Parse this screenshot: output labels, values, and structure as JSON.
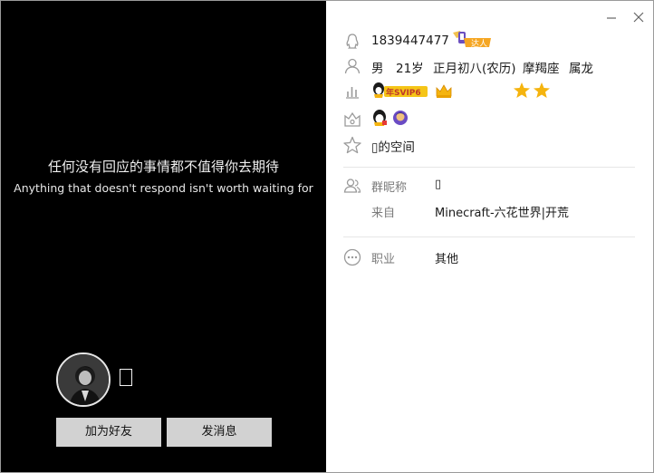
{
  "profile": {
    "signature_cn": "任何没有回应的事情都不值得你去期待",
    "signature_en": "Anything that doesn't respond isn't worth waiting for",
    "nickname": "▯",
    "add_friend_label": "加为好友",
    "send_message_label": "发消息"
  },
  "info": {
    "qq_number": "1839447477",
    "talent_badge": "达人",
    "gender": "男",
    "age": "21岁",
    "birthday": "正月初八(农历)",
    "zodiac": "摩羯座",
    "chinese_zodiac": "属龙",
    "vip_badge": "年SVIP6",
    "space_label": "▯的空间"
  },
  "group": {
    "nickname_label": "群昵称",
    "nickname_value": "▯",
    "from_label": "来自",
    "from_value": "Minecraft-六花世界|开荒"
  },
  "career": {
    "label": "职业",
    "value": "其他"
  },
  "icons": {
    "qq": "qq-penguin-icon",
    "person": "person-icon",
    "level": "level-chart-icon",
    "vip_rank": "crown-moon-star-icons",
    "badges": "badge-icon",
    "space": "star-outline-icon",
    "group": "group-people-icon",
    "career": "more-dots-icon"
  },
  "colors": {
    "left_bg": "#000000",
    "button_bg": "#d2d2d2",
    "gold": "#f5b40f",
    "text_gray": "#7a7a7a"
  }
}
